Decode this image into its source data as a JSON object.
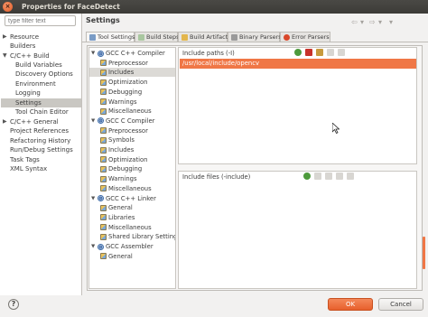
{
  "window": {
    "title": "Properties for FaceDetect",
    "close_glyph": "×"
  },
  "sidebar": {
    "filter_placeholder": "type filter text",
    "items": [
      {
        "label": "Resource",
        "expandable": true,
        "expanded": false
      },
      {
        "label": "Builders",
        "expandable": false
      },
      {
        "label": "C/C++ Build",
        "expandable": true,
        "expanded": true
      },
      {
        "label": "Build Variables",
        "expandable": false
      },
      {
        "label": "Discovery Options",
        "expandable": false
      },
      {
        "label": "Environment",
        "expandable": false
      },
      {
        "label": "Logging",
        "expandable": false
      },
      {
        "label": "Settings",
        "expandable": false,
        "selected": true
      },
      {
        "label": "Tool Chain Editor",
        "expandable": false
      },
      {
        "label": "C/C++ General",
        "expandable": true,
        "expanded": false
      },
      {
        "label": "Project References",
        "expandable": false
      },
      {
        "label": "Refactoring History",
        "expandable": false
      },
      {
        "label": "Run/Debug Settings",
        "expandable": false
      },
      {
        "label": "Task Tags",
        "expandable": false
      },
      {
        "label": "XML Syntax",
        "expandable": false
      }
    ]
  },
  "header": {
    "title": "Settings"
  },
  "tabs": [
    {
      "label": "Tool Settings",
      "active": true
    },
    {
      "label": "Build Steps",
      "active": false
    },
    {
      "label": "Build Artifact",
      "active": false
    },
    {
      "label": "Binary Parsers",
      "active": false
    },
    {
      "label": "Error Parsers",
      "active": false
    }
  ],
  "tool_tree": [
    {
      "label": "GCC C++ Compiler",
      "level": 0,
      "icon": "gear-icon"
    },
    {
      "label": "Preprocessor",
      "level": 1,
      "icon": "option-icon"
    },
    {
      "label": "Includes",
      "level": 1,
      "icon": "option-icon",
      "selected": true
    },
    {
      "label": "Optimization",
      "level": 1,
      "icon": "option-icon"
    },
    {
      "label": "Debugging",
      "level": 1,
      "icon": "option-icon"
    },
    {
      "label": "Warnings",
      "level": 1,
      "icon": "option-icon"
    },
    {
      "label": "Miscellaneous",
      "level": 1,
      "icon": "option-icon"
    },
    {
      "label": "GCC C Compiler",
      "level": 0,
      "icon": "gear-icon"
    },
    {
      "label": "Preprocessor",
      "level": 1,
      "icon": "option-icon"
    },
    {
      "label": "Symbols",
      "level": 1,
      "icon": "option-icon"
    },
    {
      "label": "Includes",
      "level": 1,
      "icon": "option-icon"
    },
    {
      "label": "Optimization",
      "level": 1,
      "icon": "option-icon"
    },
    {
      "label": "Debugging",
      "level": 1,
      "icon": "option-icon"
    },
    {
      "label": "Warnings",
      "level": 1,
      "icon": "option-icon"
    },
    {
      "label": "Miscellaneous",
      "level": 1,
      "icon": "option-icon"
    },
    {
      "label": "GCC C++ Linker",
      "level": 0,
      "icon": "gear-icon"
    },
    {
      "label": "General",
      "level": 1,
      "icon": "option-icon"
    },
    {
      "label": "Libraries",
      "level": 1,
      "icon": "option-icon"
    },
    {
      "label": "Miscellaneous",
      "level": 1,
      "icon": "option-icon"
    },
    {
      "label": "Shared Library Settings",
      "level": 1,
      "icon": "option-icon"
    },
    {
      "label": "GCC Assembler",
      "level": 0,
      "icon": "gear-icon"
    },
    {
      "label": "General",
      "level": 1,
      "icon": "option-icon"
    }
  ],
  "include_paths": {
    "label": "Include paths (-I)",
    "items": [
      "/usr/local/include/opencv"
    ]
  },
  "include_files": {
    "label": "Include files (-include)",
    "items": []
  },
  "footer": {
    "help_glyph": "?",
    "ok_label": "OK",
    "cancel_label": "Cancel"
  },
  "colors": {
    "accent": "#f07746",
    "selection": "#dcdad6"
  }
}
